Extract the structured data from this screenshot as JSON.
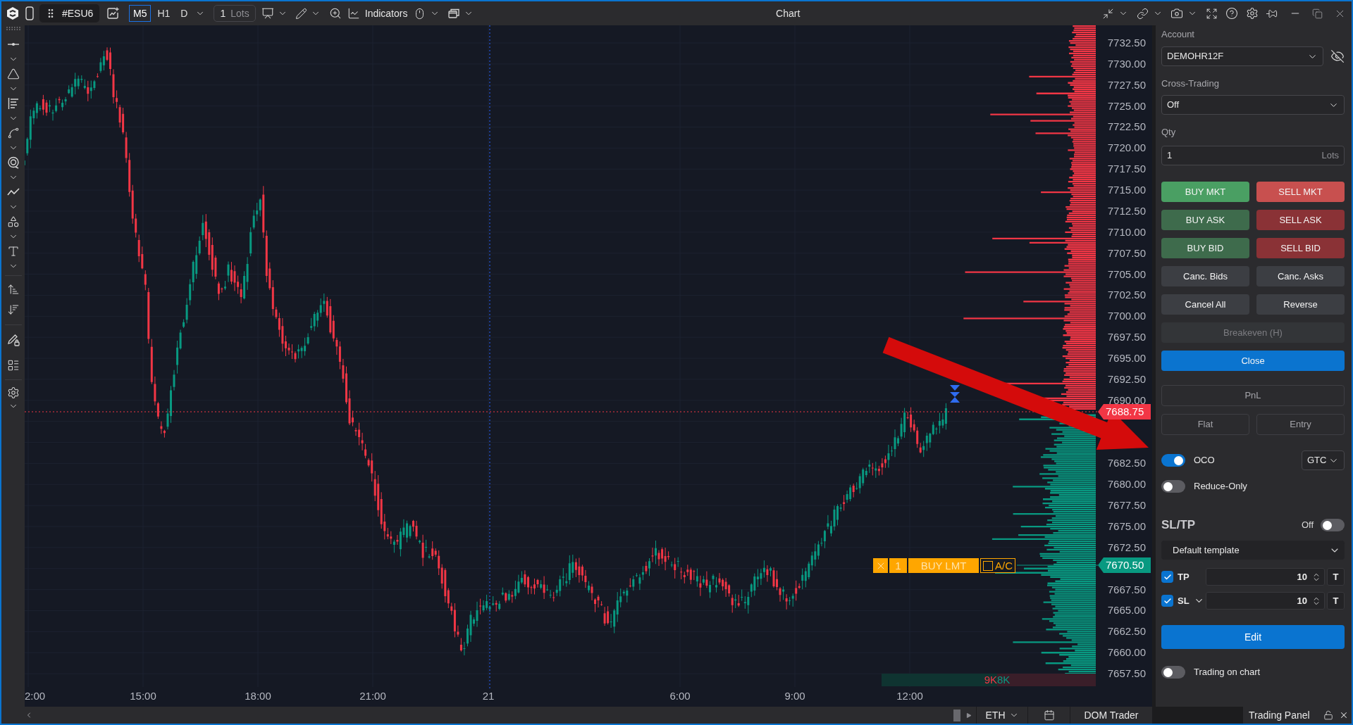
{
  "window": {
    "title": "Chart"
  },
  "toolbar": {
    "symbol": "#ESU6",
    "timeframes": [
      {
        "label": "M5",
        "selected": true
      },
      {
        "label": "H1",
        "selected": false
      },
      {
        "label": "D",
        "selected": false
      }
    ],
    "quantity": {
      "value": "1",
      "unit": "Lots"
    },
    "indicators": "Indicators"
  },
  "chart": {
    "price_labels": [
      "7732.50",
      "7730.00",
      "7727.50",
      "7725.00",
      "7722.50",
      "7720.00",
      "7717.50",
      "7715.00",
      "7712.50",
      "7710.00",
      "7707.50",
      "7705.00",
      "7702.50",
      "7700.00",
      "7697.50",
      "7695.00",
      "7692.50",
      "7690.00",
      "7682.50",
      "7680.00",
      "7677.50",
      "7675.00",
      "7672.50",
      "7667.50",
      "7665.00",
      "7662.50",
      "7660.00",
      "7657.50"
    ],
    "time_labels": [
      "2:00",
      "15:00",
      "18:00",
      "21:00",
      "21",
      "6:00",
      "9:00",
      "12:00"
    ],
    "last_price": "7688.75",
    "order": {
      "quantity": "1",
      "label": "BUY LMT",
      "ac_label": "A/C",
      "ac_checked": false,
      "price": "7670.50"
    },
    "volume_summary": {
      "sell": "9K",
      "buy": "8K"
    }
  },
  "status_bar": {
    "session": "ETH",
    "dom_tab": "DOM Trader"
  },
  "trading_panel": {
    "account": {
      "label": "Account",
      "value": "DEMOHR12F"
    },
    "cross_trading": {
      "label": "Cross-Trading",
      "value": "Off"
    },
    "qty": {
      "label": "Qty",
      "value": "1",
      "unit": "Lots"
    },
    "order_buttons": [
      {
        "label": "BUY MKT",
        "kind": "half",
        "color": "#4a9f63",
        "disabled": false
      },
      {
        "label": "SELL MKT",
        "kind": "half",
        "color": "#c8504f",
        "disabled": false
      },
      {
        "label": "BUY ASK",
        "kind": "half",
        "color": "#3e6b4c",
        "disabled": false
      },
      {
        "label": "SELL ASK",
        "kind": "half",
        "color": "#8a3236",
        "disabled": false
      },
      {
        "label": "BUY BID",
        "kind": "half",
        "color": "#3e6b4c",
        "disabled": false
      },
      {
        "label": "SELL BID",
        "kind": "half",
        "color": "#8a3236",
        "disabled": false
      },
      {
        "label": "Canc. Bids",
        "kind": "half",
        "color": "#3c3e43",
        "disabled": false
      },
      {
        "label": "Canc. Asks",
        "kind": "half",
        "color": "#3c3e43",
        "disabled": false
      },
      {
        "label": "Cancel All",
        "kind": "half",
        "color": "#3c3e43",
        "disabled": false
      },
      {
        "label": "Reverse",
        "kind": "half",
        "color": "#3c3e43",
        "disabled": false
      },
      {
        "label": "Breakeven (H)",
        "kind": "wide",
        "color": "#333538",
        "disabled": true
      },
      {
        "label": "Close",
        "kind": "wide",
        "color": "#0b74cf",
        "disabled": false
      }
    ],
    "position_buttons": [
      {
        "label": "PnL",
        "kind": "wide"
      },
      {
        "label": "Flat",
        "kind": "half"
      },
      {
        "label": "Entry",
        "kind": "half"
      }
    ],
    "oco": {
      "label": "OCO",
      "on": true
    },
    "time_in_force": "GTC",
    "reduce_only": {
      "label": "Reduce-Only",
      "on": false
    },
    "sl_tp": {
      "title": "SL/TP",
      "status": "Off",
      "on": false,
      "template": "Default template",
      "rows": [
        {
          "label": "TP",
          "kind": "plain",
          "checked": true,
          "value": "10",
          "unit": "T"
        },
        {
          "label": "SL",
          "kind": "menu",
          "checked": true,
          "value": "10",
          "unit": "T"
        }
      ]
    },
    "edit_button": "Edit",
    "trading_on_chart": {
      "label": "Trading on chart",
      "on": false
    }
  },
  "panel_tab": {
    "label": "Trading Panel"
  }
}
